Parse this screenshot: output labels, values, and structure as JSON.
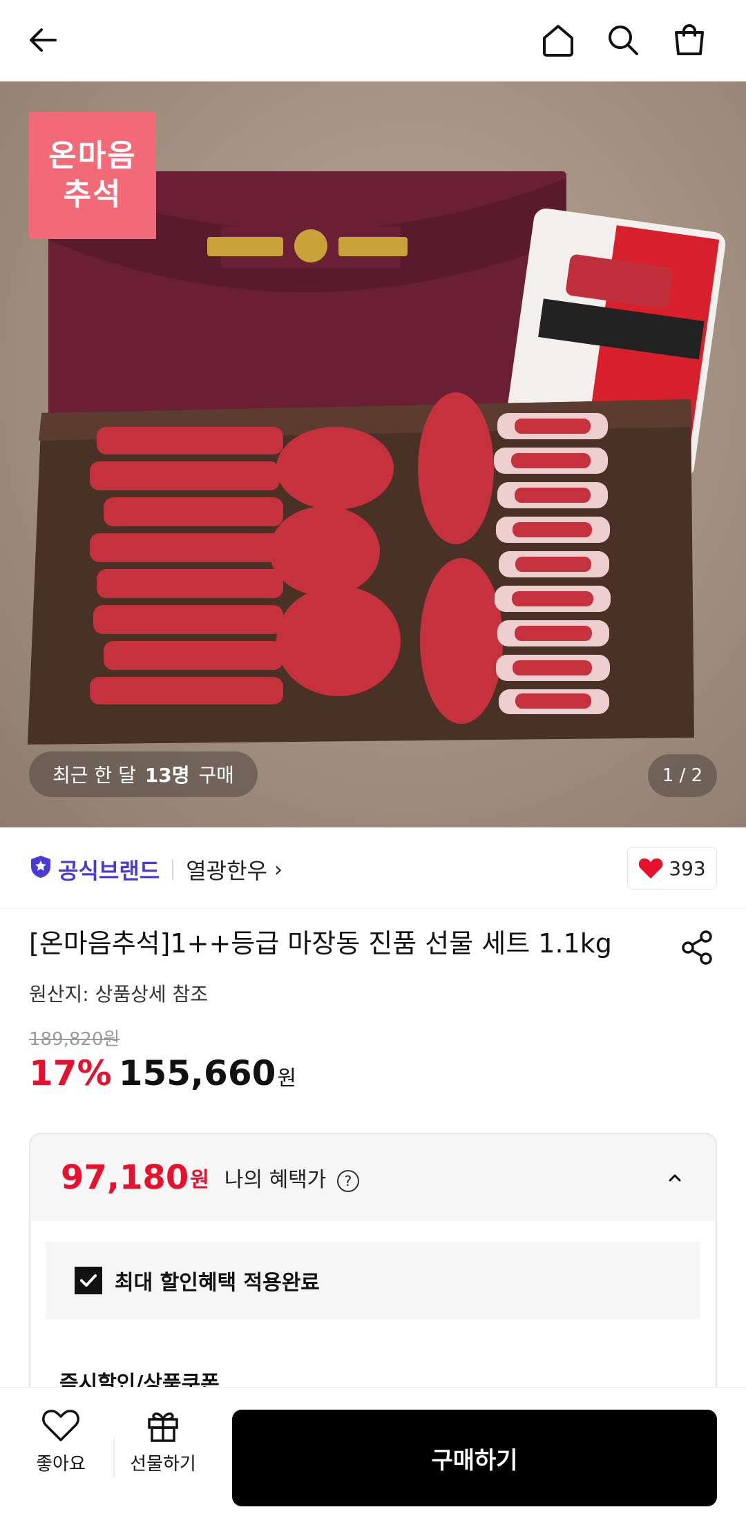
{
  "header": {
    "back_icon": "arrow-left-icon",
    "home_icon": "home-icon",
    "search_icon": "search-icon",
    "cart_icon": "shopping-bag-icon"
  },
  "hero": {
    "badge_line1": "온마음",
    "badge_line2": "추석",
    "purchase_prefix": "최근 한 달",
    "purchase_count": "13명",
    "purchase_suffix": "구매",
    "pager": "1 / 2"
  },
  "brand": {
    "official_label": "공식브랜드",
    "name": "열광한우",
    "chevron": "›",
    "like_count": "393"
  },
  "product": {
    "title": "[온마음추석]1++등급 마장동 진품 선물 세트 1.1kg",
    "origin": "원산지: 상품상세 참조",
    "original_price": "189,820원",
    "discount": "17%",
    "price": "155,660",
    "currency": "원"
  },
  "benefit": {
    "price": "97,180",
    "currency": "원",
    "label": "나의 혜택가",
    "help": "?",
    "applied": "최대 할인혜택 적용완료",
    "coupon_heading": "즉시할인/상품쿠폰"
  },
  "bottom": {
    "like_label": "좋아요",
    "gift_label": "선물하기",
    "buy_label": "구매하기"
  },
  "colors": {
    "accent_red": "#e8112d",
    "brand_purple": "#4b3bd6",
    "badge_pink": "#f26a78",
    "buy_button": "#000000"
  }
}
